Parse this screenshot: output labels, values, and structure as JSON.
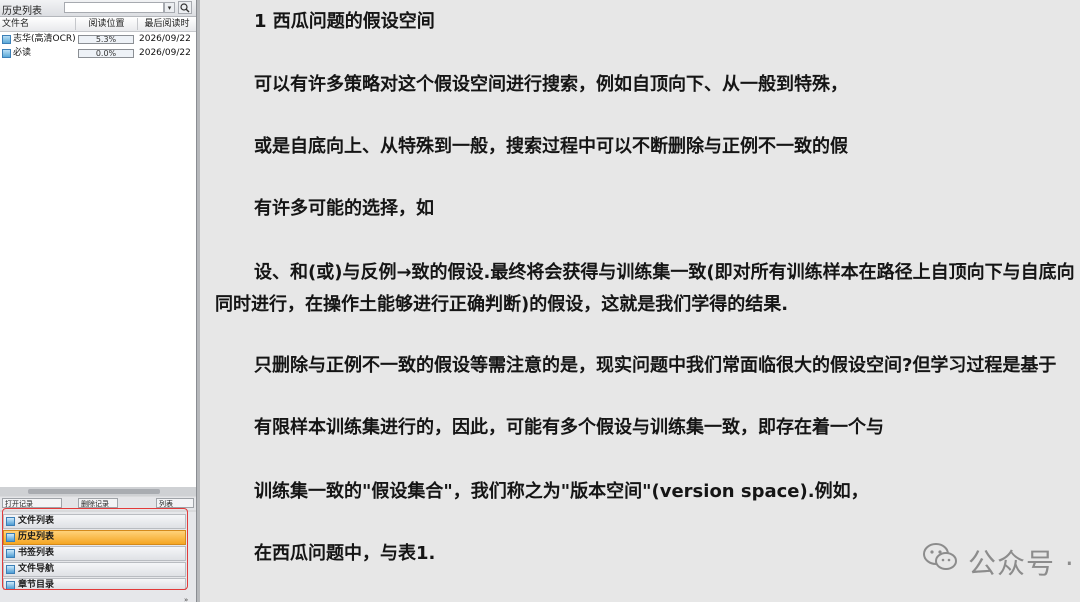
{
  "sidebar": {
    "title": "历史列表",
    "search": {
      "value": "",
      "arrow": "▾",
      "button_icon": "magnifier-icon"
    },
    "columns": {
      "name": "文件名",
      "position": "阅读位置",
      "last_read": "最后阅读时"
    },
    "rows": [
      {
        "name": "志华(高清OCR)",
        "position": "5.3%",
        "last_read": "2026/09/22"
      },
      {
        "name": "必读",
        "position": "0.0%",
        "last_read": "2026/09/22"
      }
    ],
    "toolbar": {
      "open_records": "打开记录",
      "delete_records": "删除记录",
      "list": "列表"
    },
    "nav": [
      {
        "label": "文件列表",
        "active": false
      },
      {
        "label": "历史列表",
        "active": true
      },
      {
        "label": "书签列表",
        "active": false
      },
      {
        "label": "文件导航",
        "active": false
      },
      {
        "label": "章节目录",
        "active": false
      }
    ],
    "nav_more": "»"
  },
  "reader": {
    "lines": [
      "1 西瓜问题的假设空间",
      "可以有许多策略对这个假设空间进行搜索，例如自顶向下、从一般到特殊，",
      "或是自底向上、从特殊到一般，搜索过程中可以不断删除与正例不一致的假",
      "有许多可能的选择，如",
      "设、和(或)与反例→致的假设.最终将会获得与训练集一致(即对所有训练样本在路径上自顶向下与自底向",
      "同时进行，在操作土能够进行正确判断)的假设，这就是我们学得的结果.",
      "只删除与正例不一致的假设等需注意的是，现实问题中我们常面临很大的假设空间?但学习过程是基于",
      "有限样本训练集进行的，因此，可能有多个假设与训练集一致，即存在着一个与",
      "训练集一致的\"假设集合\"，我们称之为\"版本空间\"(version space).例如，",
      "在西瓜问题中，与表1."
    ],
    "watermark": "公众号 · 生产力攻略"
  }
}
